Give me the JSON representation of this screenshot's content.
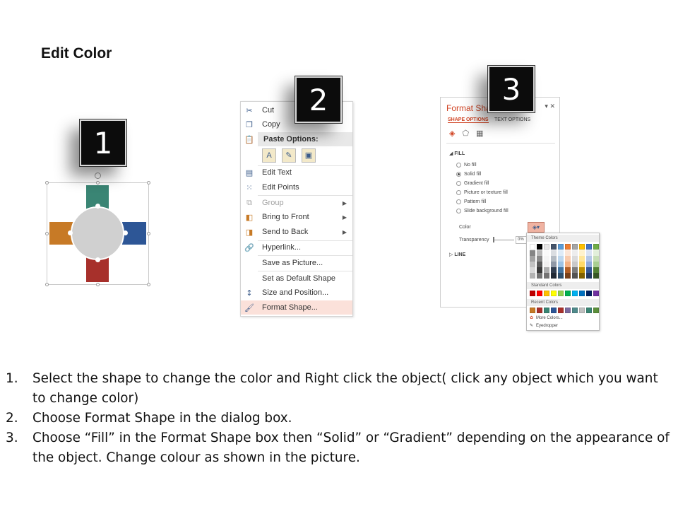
{
  "title": "Edit Color",
  "badges": {
    "one": "1",
    "two": "2",
    "three": "3"
  },
  "diagram": {
    "colors": {
      "top": "#3a8574",
      "left": "#c77a26",
      "right": "#2d5696",
      "bottom": "#a7302b",
      "hub": "#d0d0d0"
    }
  },
  "context_menu": {
    "items": [
      {
        "label": "Cut",
        "icon": "scissors-icon"
      },
      {
        "label": "Copy",
        "icon": "copy-icon"
      },
      {
        "label": "Paste Options:",
        "icon": "paste-icon"
      },
      {
        "label": "Edit Text",
        "icon": "edit-text-icon"
      },
      {
        "label": "Edit Points",
        "icon": "edit-points-icon"
      },
      {
        "label": "Group",
        "icon": "group-icon",
        "disabled": true
      },
      {
        "label": "Bring to Front",
        "icon": "bring-front-icon",
        "submenu": true
      },
      {
        "label": "Send to Back",
        "icon": "send-back-icon",
        "submenu": true
      },
      {
        "label": "Hyperlink...",
        "icon": "hyperlink-icon"
      },
      {
        "label": "Save as Picture...",
        "icon": ""
      },
      {
        "label": "Set as Default Shape",
        "icon": ""
      },
      {
        "label": "Size and Position...",
        "icon": "size-position-icon"
      },
      {
        "label": "Format Shape...",
        "icon": "format-shape-icon",
        "highlighted": true
      }
    ]
  },
  "format_pane": {
    "title": "Format Sha",
    "tab_shape": "SHAPE OPTIONS",
    "tab_text": "TEXT OPTIONS",
    "fill_section": "FILL",
    "fill_options": [
      "No fill",
      "Solid fill",
      "Gradient fill",
      "Picture or texture fill",
      "Pattern fill",
      "Slide background fill"
    ],
    "selected_fill": "Solid fill",
    "color_label": "Color",
    "transparency_label": "Transparency",
    "transparency_value": "0%",
    "line_section": "LINE"
  },
  "palette": {
    "theme_label": "Theme Colors",
    "standard_label": "Standard Colors",
    "recent_label": "Recent Colors",
    "more_colors": "More Colors...",
    "eyedropper": "Eyedropper",
    "theme_top": [
      "#ffffff",
      "#000000",
      "#e7e6e6",
      "#44546a",
      "#5b9bd5",
      "#ed7d31",
      "#a5a5a5",
      "#ffc000",
      "#4472c4",
      "#70ad47"
    ],
    "standard": [
      "#c00000",
      "#ff0000",
      "#ffc000",
      "#ffff00",
      "#92d050",
      "#00b050",
      "#00b0f0",
      "#0070c0",
      "#002060",
      "#7030a0"
    ],
    "recent": [
      "#c77a26",
      "#a7302b",
      "#3a8574",
      "#2d5696",
      "#a7302b",
      "#7b6a9e",
      "#4f8a8b",
      "#c0c0c0",
      "#3a8574",
      "#5b8f3a"
    ]
  },
  "instructions": [
    {
      "num": "1.",
      "text": "Select the shape to change the color and Right click the object( click any object which you want to change color)"
    },
    {
      "num": "2.",
      "text": "Choose Format Shape in the dialog box."
    },
    {
      "num": "3.",
      "text": "Choose “Fill” in the Format Shape box then “Solid” or “Gradient” depending on the appearance of the object. Change colour as shown in the picture."
    }
  ]
}
